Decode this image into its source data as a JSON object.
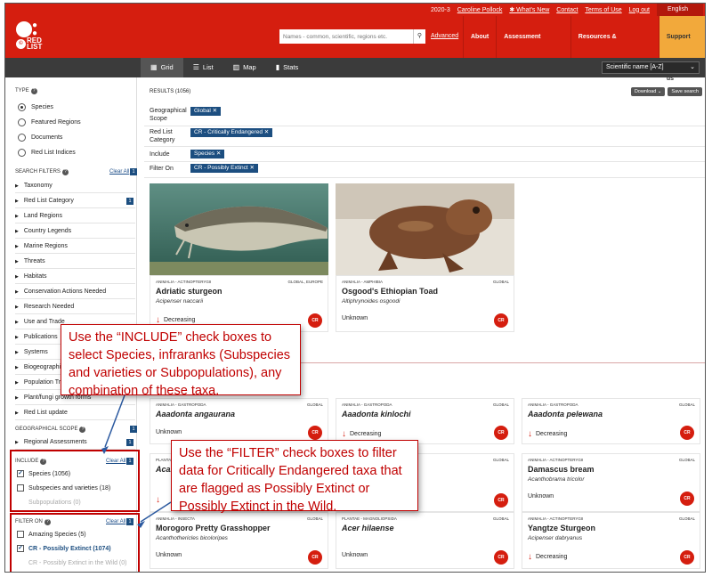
{
  "topbar": {
    "version": "2020-3",
    "user": "Caroline Pollock",
    "whats_new": "✱ What's New",
    "contact": "Contact",
    "terms": "Terms of Use",
    "logout": "Log out",
    "language": "English"
  },
  "header": {
    "logo_text": "RED LIST",
    "search_placeholder": "Names - common, scientific, regions etc.",
    "advanced": "Advanced",
    "nav": [
      "About",
      "Assessment process",
      "Resources & Publications",
      "Support us"
    ]
  },
  "toolbar": {
    "views": [
      "Grid",
      "List",
      "Map",
      "Stats"
    ],
    "sort": "Scientific name [A-Z]"
  },
  "sidebar": {
    "type_label": "TYPE",
    "types": [
      "Species",
      "Featured Regions",
      "Documents",
      "Red List Indices"
    ],
    "search_filters_label": "SEARCH FILTERS",
    "clear_all": "Clear All",
    "search_filters_count": "1",
    "filters": [
      "Taxonomy",
      "Red List Category",
      "Land Regions",
      "Country Legends",
      "Marine Regions",
      "Threats",
      "Habitats",
      "Conservation Actions Needed",
      "Research Needed",
      "Use and Trade",
      "Publications",
      "Systems",
      "Biogeographical Realms",
      "Population Trend",
      "Plant/fungi growth forms",
      "Red List update"
    ],
    "red_list_category_count": "1",
    "geo_label": "GEOGRAPHICAL SCOPE",
    "geo_item": "Regional Assessments",
    "geo_count": "1",
    "include_label": "INCLUDE",
    "include_count": "1",
    "include_items": [
      "Species (1056)",
      "Subspecies and varieties (18)",
      "Subpopulations (0)"
    ],
    "filter_on_label": "FILTER ON",
    "filter_on_count": "1",
    "filter_on_items": [
      "Amazing Species (5)",
      "CR - Possibly Extinct (1074)",
      "CR - Possibly Extinct in the Wild (0)"
    ]
  },
  "results": {
    "title": "RESULTS (1056)",
    "download": "Download ⌄",
    "save": "Save search",
    "criteria": [
      {
        "label": "Geographical Scope",
        "chip": "Global ✕"
      },
      {
        "label": "Red List Category",
        "chip": "CR - Critically Endangered ✕"
      },
      {
        "label": "Include",
        "chip": "Species ✕"
      },
      {
        "label": "Filter On",
        "chip": "CR - Possibly Extinct ✕"
      }
    ],
    "featured": [
      {
        "tax": "ANIMALIA - ACTINOPTERYGII",
        "scope": "GLOBAL, EUROPE",
        "name": "Adriatic sturgeon",
        "sci": "Acipenser naccarii",
        "trend": "Decreasing"
      },
      {
        "tax": "ANIMALIA - AMPHIBIA",
        "scope": "GLOBAL",
        "name": "Osgood's Ethiopian Toad",
        "sci": "Altiphrynoides osgoodi",
        "trend": "Unknown"
      }
    ],
    "cards": [
      {
        "tax": "ANIMALIA - GASTROPODA",
        "scope": "GLOBAL",
        "name": "Aaadonta angaurana",
        "sci": "",
        "trend": "Unknown"
      },
      {
        "tax": "ANIMALIA - GASTROPODA",
        "scope": "GLOBAL",
        "name": "Aaadonta kinlochi",
        "sci": "",
        "trend": "Decreasing"
      },
      {
        "tax": "ANIMALIA - GASTROPODA",
        "scope": "GLOBAL",
        "name": "Aaadonta pelewana",
        "sci": "",
        "trend": "Decreasing"
      },
      {
        "tax": "PLANTAE - ...",
        "scope": "GLOBAL",
        "name": "Acal...",
        "sci": "",
        "trend": ""
      },
      {
        "tax": "ANIMALIA - ...",
        "scope": "GLOBAL",
        "name": "",
        "sci": "",
        "trend": ""
      },
      {
        "tax": "ANIMALIA - ACTINOPTERYGII",
        "scope": "GLOBAL",
        "name": "Damascus bream",
        "sci": "Acanthobrama tricolor",
        "trend": "Unknown"
      },
      {
        "tax": "ANIMALIA - INSECTA",
        "scope": "GLOBAL",
        "name": "Morogoro Pretty Grasshopper",
        "sci": "Acanthothericles bicoloripes",
        "trend": "Unknown"
      },
      {
        "tax": "PLANTAE - MAGNOLIOPSIDA",
        "scope": "GLOBAL",
        "name": "Acer hilaense",
        "sci": "",
        "trend": "Unknown"
      },
      {
        "tax": "ANIMALIA - ACTINOPTERYGII",
        "scope": "GLOBAL",
        "name": "Yangtze Sturgeon",
        "sci": "Acipenser dabryanus",
        "trend": "Decreasing"
      }
    ],
    "cr_badge": "CR"
  },
  "callouts": {
    "include": "Use the “INCLUDE” check boxes to select Species, infraranks (Subspecies and varieties or Subpopulations), any combination of these taxa.",
    "filter": "Use the “FILTER” check boxes to filter data for Critically Endangered taxa that are flagged as Possibly Extinct or Possibly Extinct in the Wild."
  },
  "colors": {
    "brand_red": "#d51e0f",
    "chip_blue": "#1c4e80",
    "support": "#f2a93b",
    "annotation": "#c00000"
  }
}
